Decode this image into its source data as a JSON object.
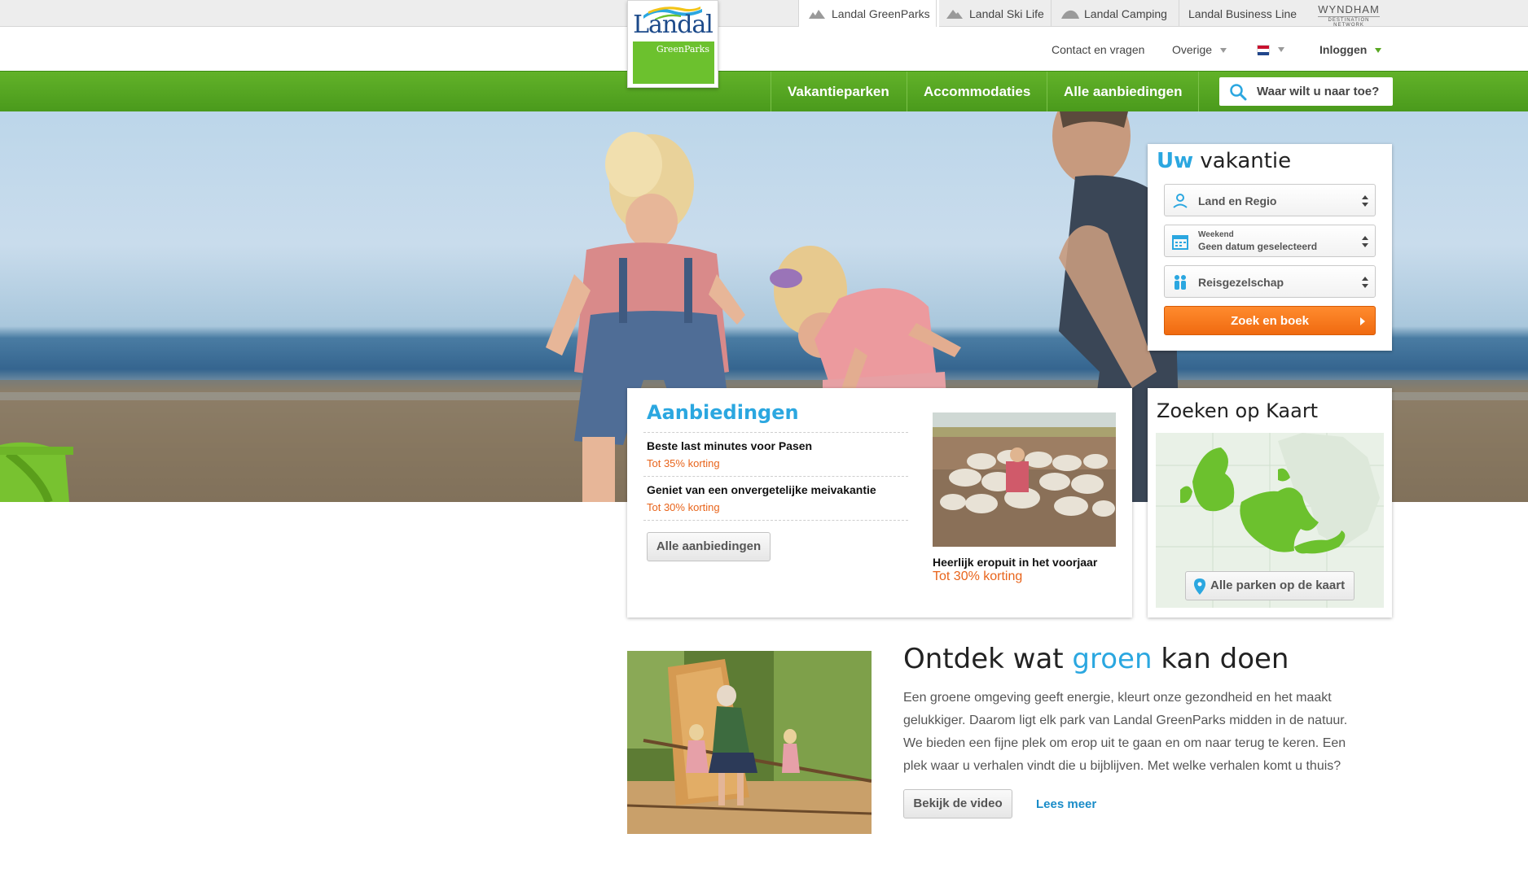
{
  "brandbar": {
    "tabs": [
      {
        "label": "Landal GreenParks",
        "icon": "greenparks-icon"
      },
      {
        "label": "Landal Ski Life",
        "icon": "mountain-icon"
      },
      {
        "label": "Landal Camping",
        "icon": "camping-icon"
      },
      {
        "label": "Landal Business Line",
        "icon": ""
      }
    ],
    "wyndham": "WYNDHAM",
    "wyndham_sub": "DESTINATION NETWORK"
  },
  "logo": {
    "name": "Landal",
    "sub": "GreenParks"
  },
  "subnav": {
    "contact": "Contact en vragen",
    "overige": "Overige",
    "login": "Inloggen"
  },
  "menu": {
    "items": [
      "Vakantieparken",
      "Accommodaties",
      "Alle aanbiedingen"
    ],
    "search_label": "Waar wilt u naar toe?"
  },
  "vakantie": {
    "title_part1": "Uw",
    "title_part2": "vakantie",
    "region": "Land en Regio",
    "date_small": "Weekend",
    "date_value": "Geen datum geselecteerd",
    "party": "Reisgezelschap",
    "submit": "Zoek en boek"
  },
  "aanbiedingen": {
    "title": "Aanbiedingen",
    "offers": [
      {
        "title": "Beste last minutes voor Pasen",
        "discount": "Tot 35% korting"
      },
      {
        "title": "Geniet van een onvergetelijke meivakantie",
        "discount": "Tot 30% korting"
      }
    ],
    "button": "Alle aanbiedingen",
    "featured_caption": "Heerlijk eropuit in het voorjaar",
    "featured_discount": "Tot 30% korting"
  },
  "kaart": {
    "title": "Zoeken op Kaart",
    "button": "Alle parken op de kaart"
  },
  "ontdek": {
    "title_pre": "Ontdek wat ",
    "title_highlight": "groen",
    "title_post": " kan doen",
    "text": "Een groene omgeving geeft energie, kleurt onze gezondheid en het maakt gelukkiger. Daarom ligt elk park van Landal GreenParks midden in de natuur. We bieden een fijne plek om erop uit te gaan en om naar terug te keren. Een plek waar u verhalen vindt die u bijblijven. Met welke verhalen komt u thuis?",
    "video_button": "Bekijk de video",
    "read_more": "Lees meer"
  },
  "colors": {
    "green": "#5aa823",
    "blue": "#2ba7e0",
    "orange": "#f06a10"
  }
}
